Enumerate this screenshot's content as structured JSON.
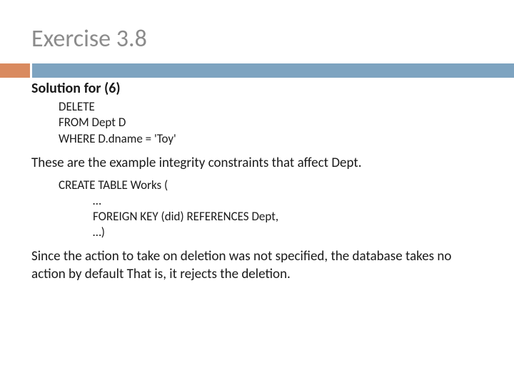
{
  "title": "Exercise 3.8",
  "subhead": "Solution for (6)",
  "code1": {
    "l1": "DELETE",
    "l2": "FROM Dept D",
    "l3": "WHERE D.dname = 'Toy'"
  },
  "para1": "These are the example integrity constraints that affect Dept.",
  "code2": {
    "l1": "CREATE TABLE Works (",
    "l2": "…",
    "l3": "FOREIGN KEY (did) REFERENCES Dept,",
    "l4": "…)"
  },
  "para2": "Since the action to take on deletion was not specified, the database takes no action by default That is, it rejects the deletion."
}
